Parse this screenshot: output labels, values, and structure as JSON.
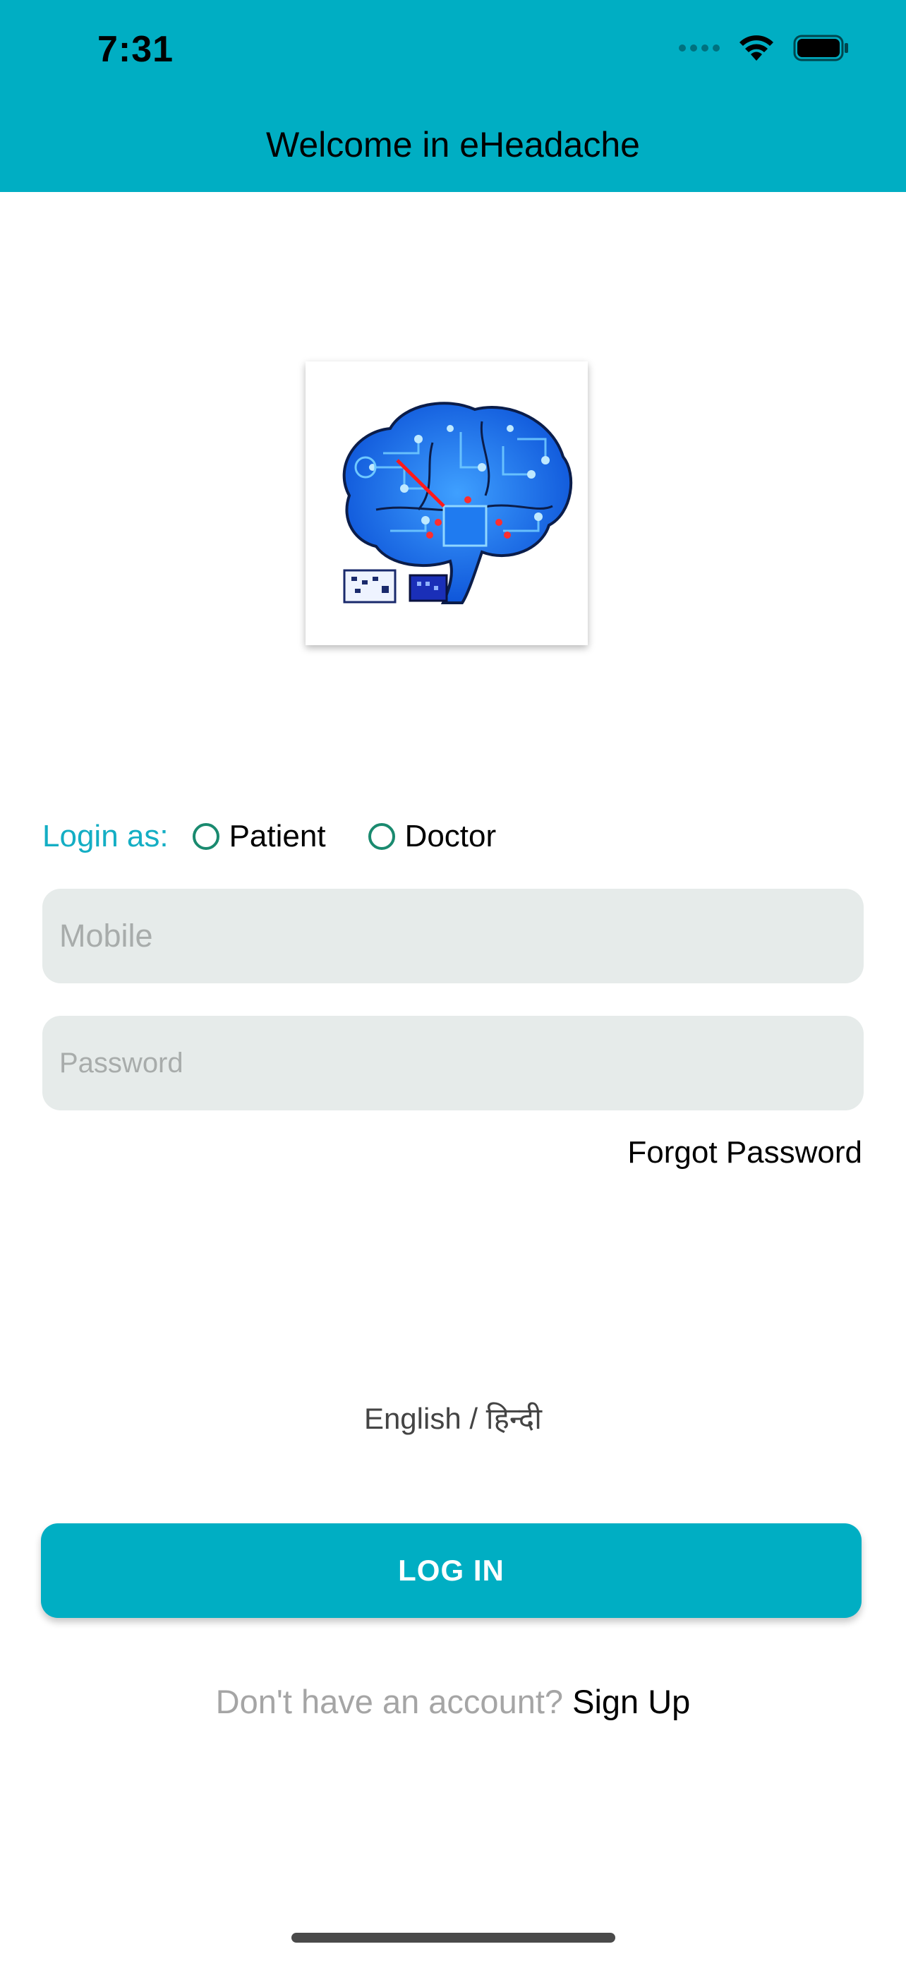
{
  "status_bar": {
    "time": "7:31"
  },
  "header": {
    "title": "Welcome in eHeadache"
  },
  "logo": {
    "name": "eHeadache brain logo"
  },
  "login_as": {
    "label": "Login as:",
    "options": [
      {
        "label": "Patient",
        "selected": false
      },
      {
        "label": "Doctor",
        "selected": false
      }
    ]
  },
  "form": {
    "mobile_placeholder": "Mobile",
    "mobile_value": "",
    "password_placeholder": "Password",
    "password_value": "",
    "forgot_label": "Forgot Password"
  },
  "language": {
    "label": "English / हिन्दी"
  },
  "login_button": {
    "label": "LOG IN"
  },
  "signup": {
    "prompt": "Don't have an account? ",
    "link": "Sign Up"
  },
  "colors": {
    "accent": "#00aec3",
    "field_bg": "#e6ebea",
    "radio": "#1a8a6f"
  },
  "icons": {
    "wifi": "wifi-icon",
    "battery": "battery-icon",
    "signal": "signal-icon"
  }
}
